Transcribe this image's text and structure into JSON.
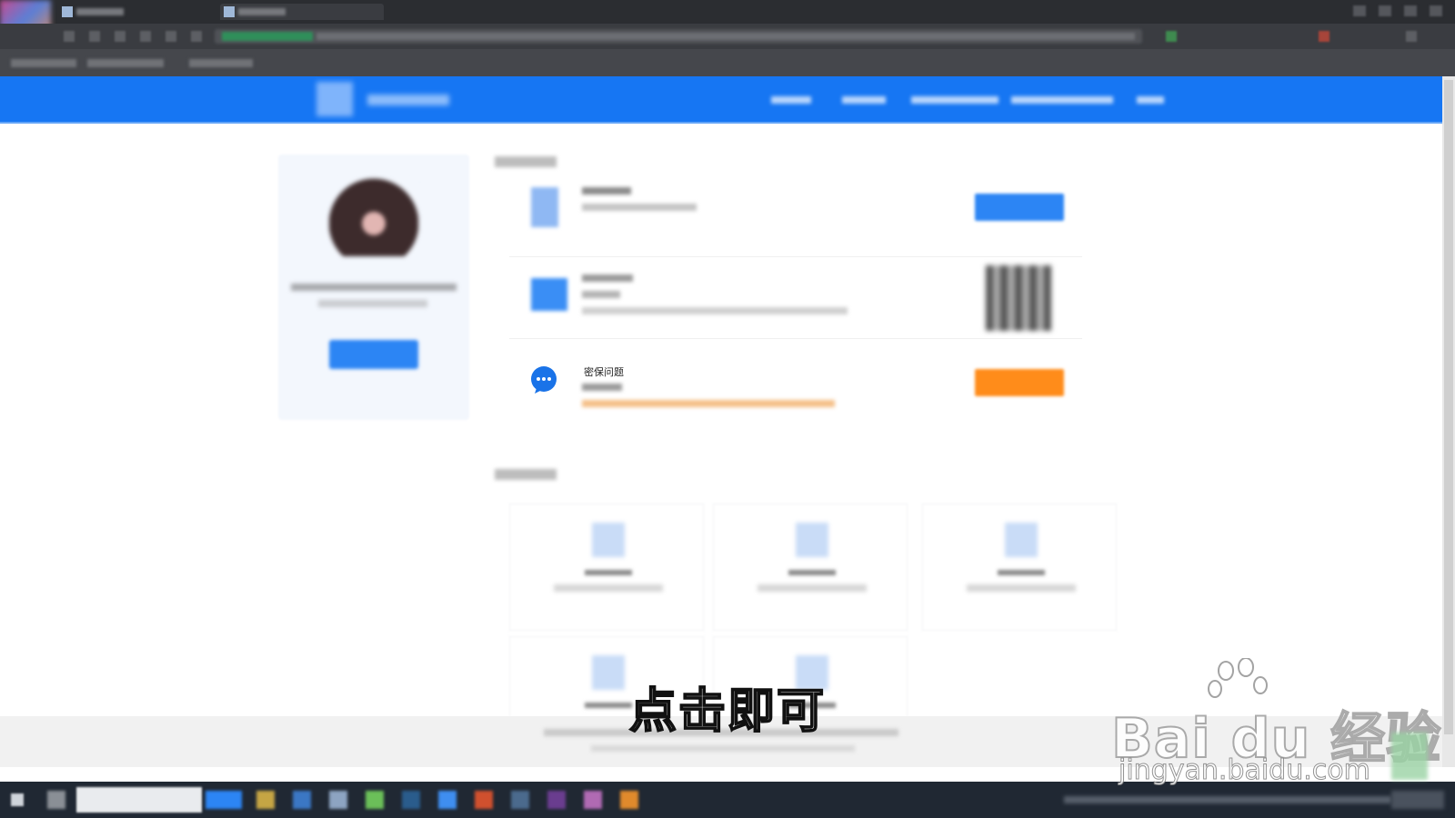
{
  "browser": {
    "tabs": [
      {
        "name": "tab-1"
      },
      {
        "name": "tab-2"
      }
    ],
    "colors": {
      "chrome": "#2b2d31",
      "toolbar": "#3a3c41"
    }
  },
  "site": {
    "header_color": "#1676f3",
    "nav_items": [
      "nav-1",
      "nav-2",
      "nav-3",
      "nav-4",
      "nav-5"
    ]
  },
  "security_section": {
    "rows": [
      {
        "icon": "phone-icon",
        "button_color": "#2c85f4"
      },
      {
        "icon": "shield-icon",
        "has_qr_code": true
      },
      {
        "icon": "chat-icon",
        "label": "密保问题",
        "button_color": "#ff8c1a"
      }
    ]
  },
  "tools_section": {
    "cards": 5
  },
  "overlay": {
    "caption": "点击即可",
    "watermark_title": "Bai du 经验",
    "watermark_url": "jingyan.baidu.com"
  }
}
